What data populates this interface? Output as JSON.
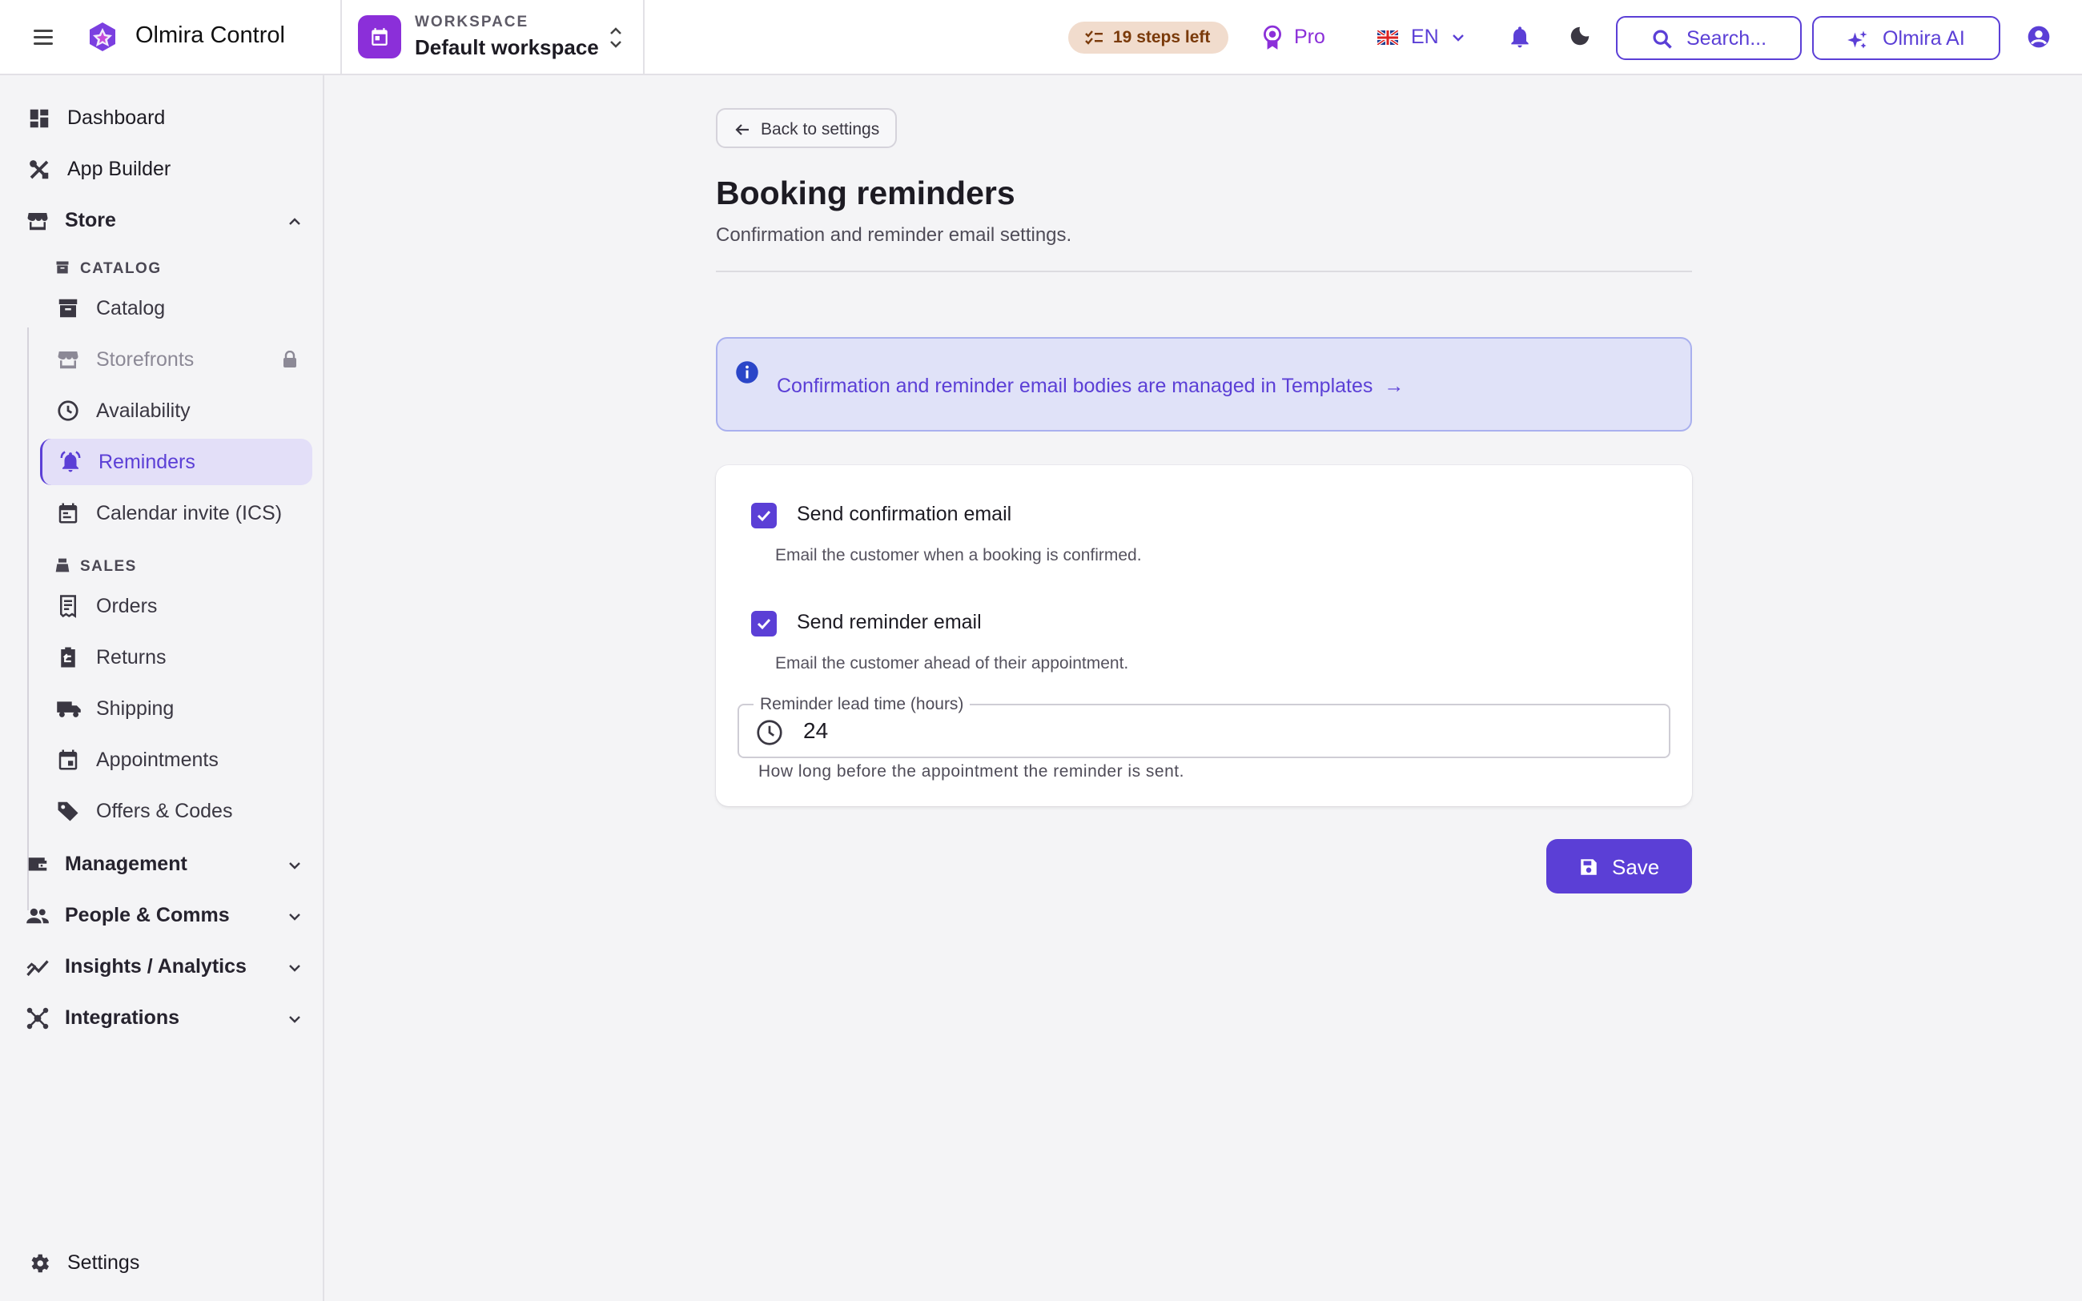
{
  "app": {
    "name": "Olmira Control"
  },
  "workspace": {
    "label": "WORKSPACE",
    "name": "Default workspace"
  },
  "topbar": {
    "steps_left": "19 steps left",
    "plan": "Pro",
    "language": "EN",
    "search_label": "Search...",
    "ai_label": "Olmira AI"
  },
  "sidebar": {
    "dashboard": "Dashboard",
    "app_builder": "App Builder",
    "store": "Store",
    "catalog_group": "CATALOG",
    "catalog": "Catalog",
    "storefronts": "Storefronts",
    "availability": "Availability",
    "reminders": "Reminders",
    "calendar_invite": "Calendar invite (ICS)",
    "sales_group": "SALES",
    "orders": "Orders",
    "returns": "Returns",
    "shipping": "Shipping",
    "appointments": "Appointments",
    "offers_codes": "Offers & Codes",
    "management": "Management",
    "people_comms": "People & Comms",
    "insights": "Insights / Analytics",
    "integrations": "Integrations",
    "settings": "Settings"
  },
  "page": {
    "back_label": "Back to settings",
    "title": "Booking reminders",
    "subtitle": "Confirmation and reminder email settings.",
    "info_text": "Confirmation and reminder email bodies are managed in Templates",
    "info_arrow": "→"
  },
  "form": {
    "confirmation": {
      "label": "Send confirmation email",
      "help": "Email the customer when a booking is confirmed.",
      "checked": true
    },
    "reminder": {
      "label": "Send reminder email",
      "help": "Email the customer ahead of their appointment.",
      "checked": true
    },
    "lead_time": {
      "label": "Reminder lead time (hours)",
      "value": "24",
      "help": "How long before the appointment the reminder is sent."
    },
    "save_label": "Save"
  },
  "colors": {
    "accent": "#5b3fd6",
    "brand_purple": "#8b2fd9",
    "active_bg": "#e3dff8",
    "info_bg": "#e0e2f8",
    "steps_pill_bg": "#f1dccd"
  },
  "icons": {
    "menu": "hamburger-icon",
    "logo": "olmira-logo",
    "workspace": "calendar-icon",
    "steps": "checklist-icon",
    "plan": "badge-icon",
    "language": "uk-flag-icon",
    "notifications": "bell-icon",
    "theme": "moon-icon",
    "search": "search-icon",
    "ai": "sparkles-icon",
    "account": "account-circle-icon"
  }
}
